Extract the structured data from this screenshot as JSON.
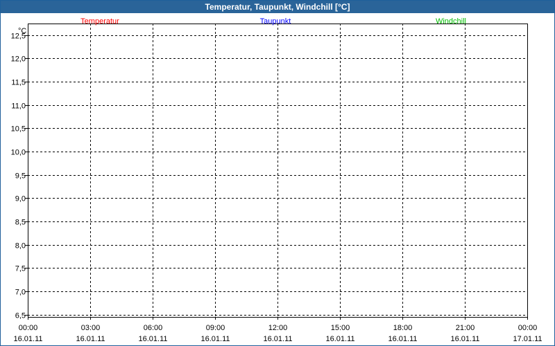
{
  "window": {
    "title": "Temperatur, Taupunkt, Windchill [°C]"
  },
  "chart_data": {
    "type": "line",
    "title": "Temperatur, Taupunkt, Windchill [°C]",
    "ylabel": "°C",
    "ylim": [
      6.45,
      12.75
    ],
    "yticks": [
      12.5,
      12.0,
      11.5,
      11.0,
      10.5,
      10.0,
      9.5,
      9.0,
      8.5,
      8.0,
      7.5,
      7.0,
      6.5
    ],
    "ytick_labels": [
      "12,5",
      "12,0",
      "11,5",
      "11,0",
      "10,5",
      "10,0",
      "9,5",
      "9,0",
      "8,5",
      "8,0",
      "7,5",
      "7,0",
      "6,5"
    ],
    "x_ticks": [
      {
        "time": "00:00",
        "date": "16.01.11"
      },
      {
        "time": "03:00",
        "date": "16.01.11"
      },
      {
        "time": "06:00",
        "date": "16.01.11"
      },
      {
        "time": "09:00",
        "date": "16.01.11"
      },
      {
        "time": "12:00",
        "date": "16.01.11"
      },
      {
        "time": "15:00",
        "date": "16.01.11"
      },
      {
        "time": "18:00",
        "date": "16.01.11"
      },
      {
        "time": "21:00",
        "date": "16.01.11"
      },
      {
        "time": "00:00",
        "date": "17.01.11"
      }
    ],
    "grid": true,
    "legend_position": "top",
    "series": [
      {
        "name": "Temperatur",
        "color": "#ff0000",
        "values": []
      },
      {
        "name": "Taupunkt",
        "color": "#0000ff",
        "values": []
      },
      {
        "name": "Windchill",
        "color": "#00bb00",
        "values": []
      }
    ]
  }
}
